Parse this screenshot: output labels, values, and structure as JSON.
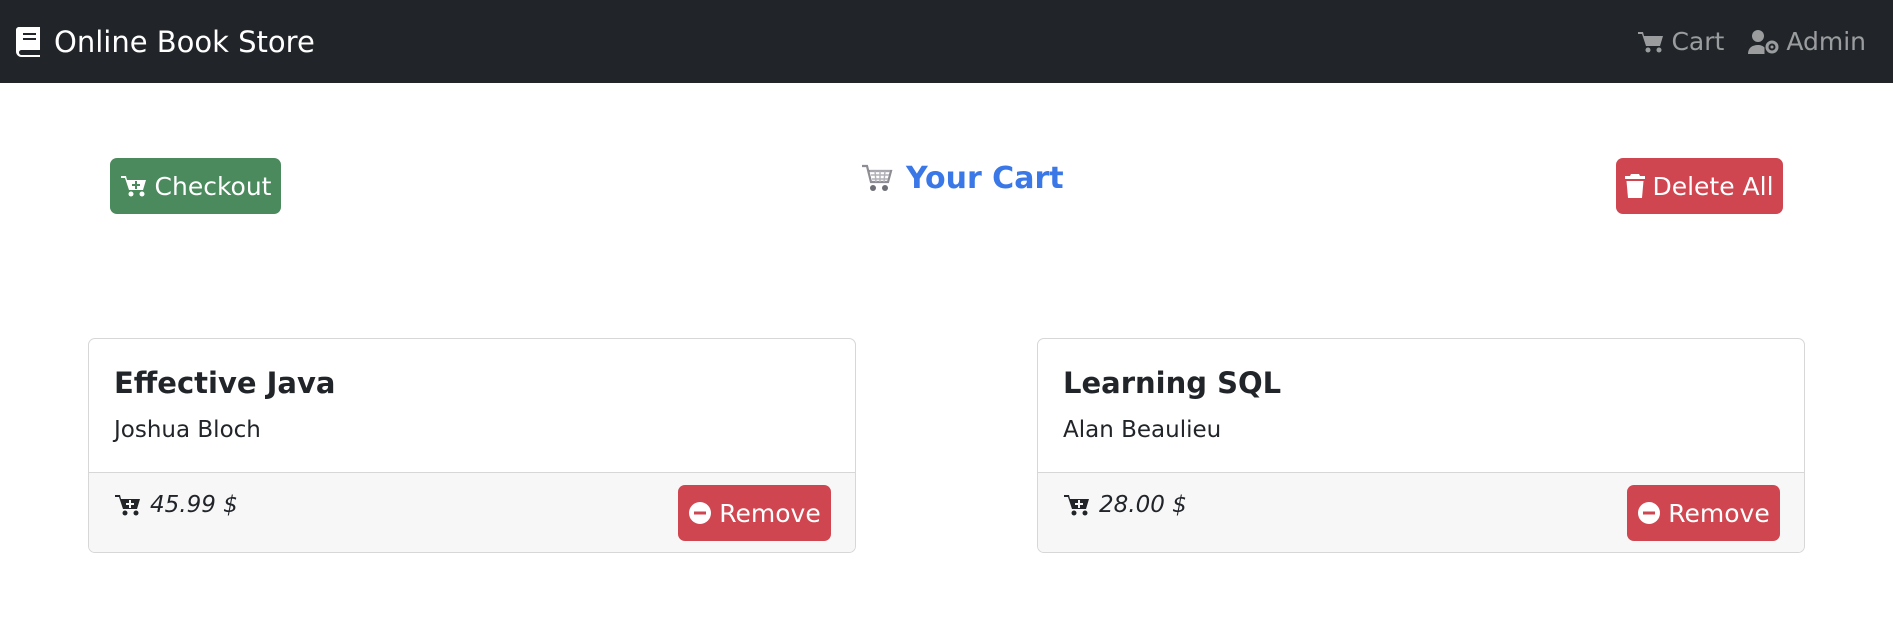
{
  "navbar": {
    "brand": "Online Book Store",
    "cart_label": "Cart",
    "admin_label": "Admin"
  },
  "actions": {
    "checkout_label": "Checkout",
    "title": "Your Cart",
    "delete_all_label": "Delete All"
  },
  "cart_items": [
    {
      "title": "Effective Java",
      "author": "Joshua Bloch",
      "price": "45.99 $",
      "remove_label": "Remove"
    },
    {
      "title": "Learning SQL",
      "author": "Alan Beaulieu",
      "price": "28.00 $",
      "remove_label": "Remove"
    }
  ],
  "colors": {
    "navbar": "#212529",
    "success": "#4a8a5c",
    "danger": "#cf4650",
    "title": "#3b78e7"
  },
  "icons": [
    "book-icon",
    "cart-icon",
    "user-gear-icon",
    "cart-plus-icon",
    "shopping-cart-icon",
    "trash-icon",
    "minus-circle-icon"
  ]
}
